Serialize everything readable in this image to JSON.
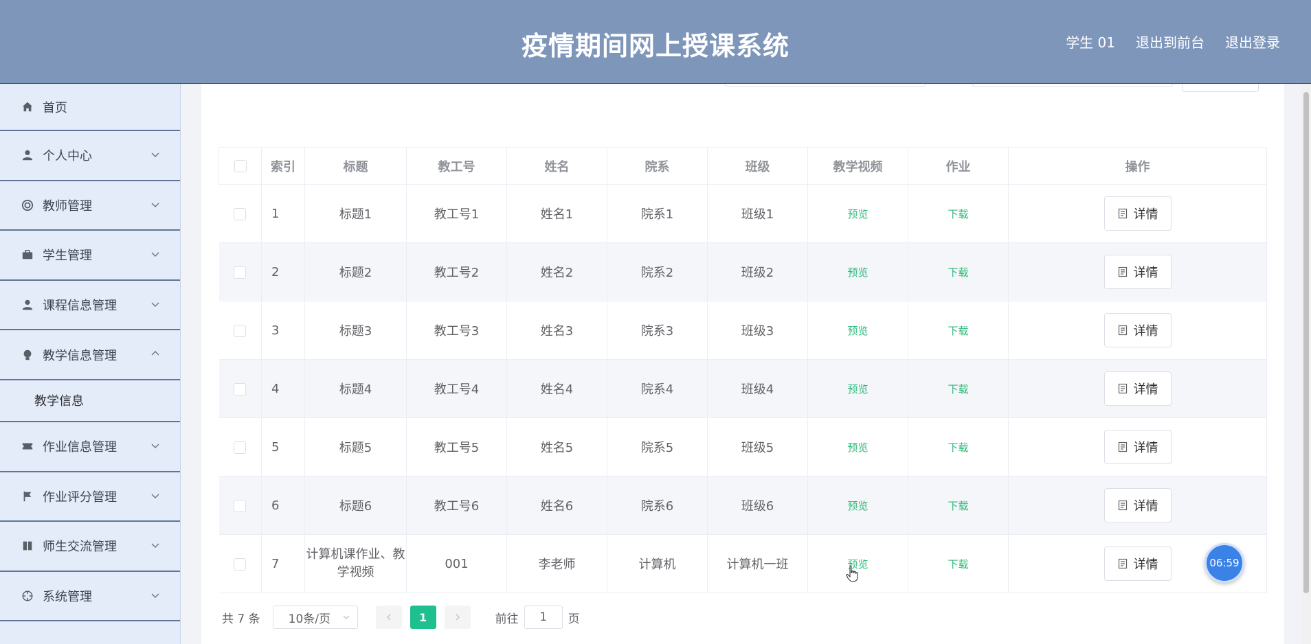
{
  "header": {
    "title": "疫情期间网上授课系统",
    "user": "学生 01",
    "exit_front": "退出到前台",
    "logout": "退出登录"
  },
  "sidebar": {
    "items": [
      {
        "label": "首页",
        "icon": "home-icon"
      },
      {
        "label": "个人中心",
        "icon": "user-icon"
      },
      {
        "label": "教师管理",
        "icon": "lifebuoy-icon"
      },
      {
        "label": "学生管理",
        "icon": "briefcase-icon"
      },
      {
        "label": "课程信息管理",
        "icon": "user-icon"
      },
      {
        "label": "教学信息管理",
        "icon": "bulb-icon"
      },
      {
        "label": "作业信息管理",
        "icon": "ticket-icon"
      },
      {
        "label": "作业评分管理",
        "icon": "flag-icon"
      },
      {
        "label": "师生交流管理",
        "icon": "book-icon"
      },
      {
        "label": "系统管理",
        "icon": "crosshair-icon"
      }
    ],
    "submenu_label": "教学信息"
  },
  "table": {
    "headers": [
      "",
      "索引",
      "标题",
      "教工号",
      "姓名",
      "院系",
      "班级",
      "教学视频",
      "作业",
      "操作"
    ],
    "preview_label": "预览",
    "download_label": "下载",
    "detail_label": "详情",
    "rows": [
      {
        "index": "1",
        "title": "标题1",
        "id": "教工号1",
        "name": "姓名1",
        "dept": "院系1",
        "cls": "班级1"
      },
      {
        "index": "2",
        "title": "标题2",
        "id": "教工号2",
        "name": "姓名2",
        "dept": "院系2",
        "cls": "班级2"
      },
      {
        "index": "3",
        "title": "标题3",
        "id": "教工号3",
        "name": "姓名3",
        "dept": "院系3",
        "cls": "班级3"
      },
      {
        "index": "4",
        "title": "标题4",
        "id": "教工号4",
        "name": "姓名4",
        "dept": "院系4",
        "cls": "班级4"
      },
      {
        "index": "5",
        "title": "标题5",
        "id": "教工号5",
        "name": "姓名5",
        "dept": "院系5",
        "cls": "班级5"
      },
      {
        "index": "6",
        "title": "标题6",
        "id": "教工号6",
        "name": "姓名6",
        "dept": "院系6",
        "cls": "班级6"
      },
      {
        "index": "7",
        "title": "计算机课作业、教学视频",
        "id": "001",
        "name": "李老师",
        "dept": "计算机",
        "cls": "计算机一班"
      }
    ]
  },
  "pagination": {
    "total": "共 7 条",
    "page_size": "10条/页",
    "current_page": "1",
    "goto_prefix": "前往",
    "goto_value": "1",
    "goto_suffix": "页"
  },
  "timer": "06:59",
  "colors": {
    "header_bg": "#7f96bb",
    "sidebar_bg": "#e4ecfa",
    "accent_green": "#1fbf8f",
    "link_green": "#2fb87a",
    "timer_blue": "#3b82e6"
  }
}
